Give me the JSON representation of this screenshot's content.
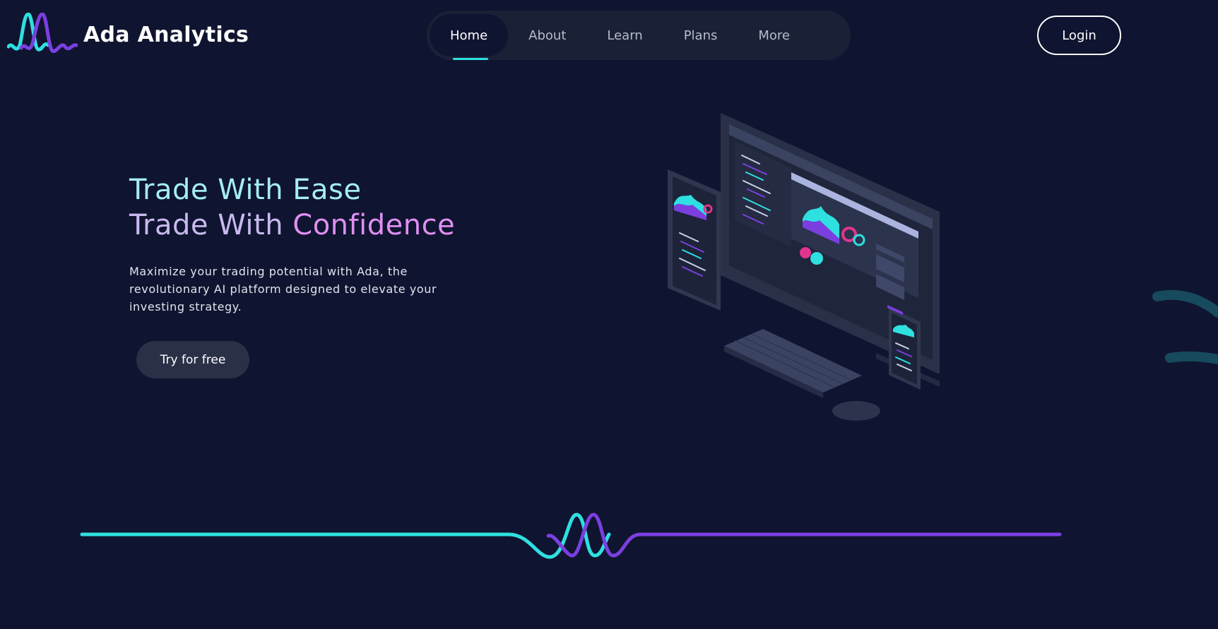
{
  "brand": {
    "name": "Ada Analytics",
    "logo_icon": "wave-logo-icon"
  },
  "nav": {
    "items": [
      {
        "label": "Home",
        "active": true
      },
      {
        "label": "About",
        "active": false
      },
      {
        "label": "Learn",
        "active": false
      },
      {
        "label": "Plans",
        "active": false
      },
      {
        "label": "More",
        "active": false
      }
    ]
  },
  "header": {
    "login_label": "Login"
  },
  "hero": {
    "line1": "Trade With Ease",
    "line2_prefix": "Trade With ",
    "line2_highlight": "Confidence",
    "description": "Maximize your trading potential with Ada, the revolutionary AI platform designed to elevate your investing strategy.",
    "cta_label": "Try for free"
  },
  "colors": {
    "background": "#0f1430",
    "accent_cyan": "#2ee0e0",
    "accent_purple": "#7b3fe0",
    "highlight_pink": "#df8ff0",
    "nav_bg": "#1a2136"
  }
}
